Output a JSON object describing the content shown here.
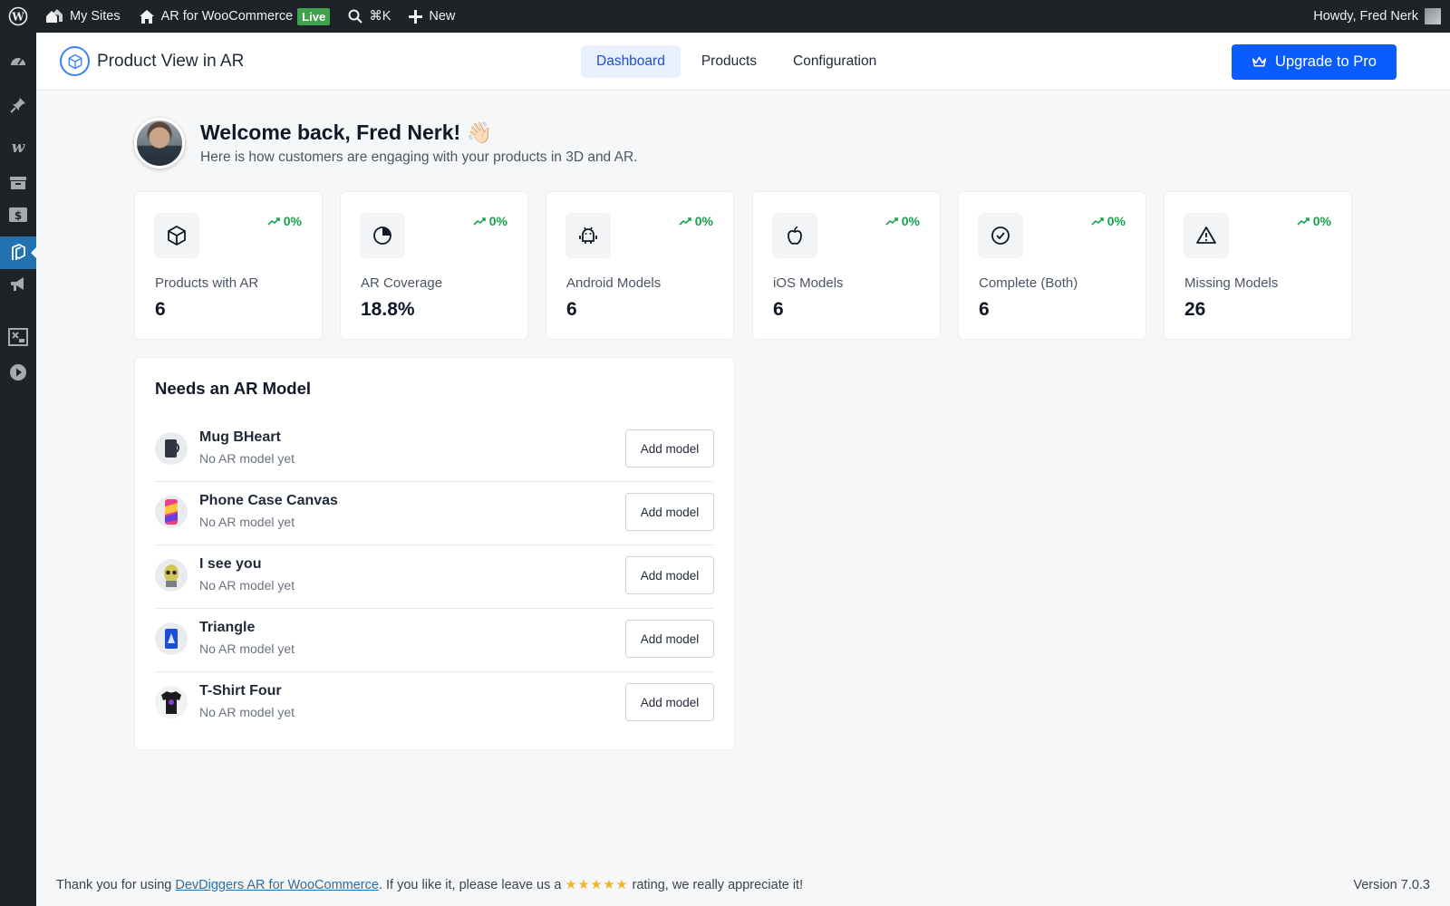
{
  "adminbar": {
    "my_sites": "My Sites",
    "site_name": "AR for WooCommerce",
    "live_badge": "Live",
    "shortcut": "⌘K",
    "new_label": "New",
    "howdy": "Howdy, Fred Nerk"
  },
  "header": {
    "brand": "Product View in AR",
    "tabs": [
      {
        "label": "Dashboard",
        "active": true
      },
      {
        "label": "Products",
        "active": false
      },
      {
        "label": "Configuration",
        "active": false
      }
    ],
    "upgrade_label": "Upgrade to Pro",
    "accent_color": "#0b5cff"
  },
  "welcome": {
    "title": "Welcome back, Fred Nerk! 👋🏻",
    "subtitle": "Here is how customers are engaging with your products in 3D and AR."
  },
  "stats": [
    {
      "icon": "cube-icon",
      "label": "Products with AR",
      "value": "6",
      "trend": "0%"
    },
    {
      "icon": "pie-chart-icon",
      "label": "AR Coverage",
      "value": "18.8%",
      "trend": "0%"
    },
    {
      "icon": "android-icon",
      "label": "Android Models",
      "value": "6",
      "trend": "0%"
    },
    {
      "icon": "apple-icon",
      "label": "iOS Models",
      "value": "6",
      "trend": "0%"
    },
    {
      "icon": "check-circle-icon",
      "label": "Complete (Both)",
      "value": "6",
      "trend": "0%"
    },
    {
      "icon": "warning-icon",
      "label": "Missing Models",
      "value": "26",
      "trend": "0%"
    }
  ],
  "needs": {
    "title": "Needs an AR Model",
    "button_label": "Add model",
    "items": [
      {
        "name": "Mug BHeart",
        "status": "No AR model yet"
      },
      {
        "name": "Phone Case Canvas",
        "status": "No AR model yet"
      },
      {
        "name": "I see you",
        "status": "No AR model yet"
      },
      {
        "name": "Triangle",
        "status": "No AR model yet"
      },
      {
        "name": "T-Shirt Four",
        "status": "No AR model yet"
      }
    ]
  },
  "footer": {
    "prefix": "Thank you for using ",
    "link_text": "DevDiggers AR for WooCommerce",
    "middle": ". If you like it, please leave us a ",
    "stars": "★★★★★",
    "suffix": " rating, we really appreciate it!",
    "version": "Version 7.0.3"
  }
}
